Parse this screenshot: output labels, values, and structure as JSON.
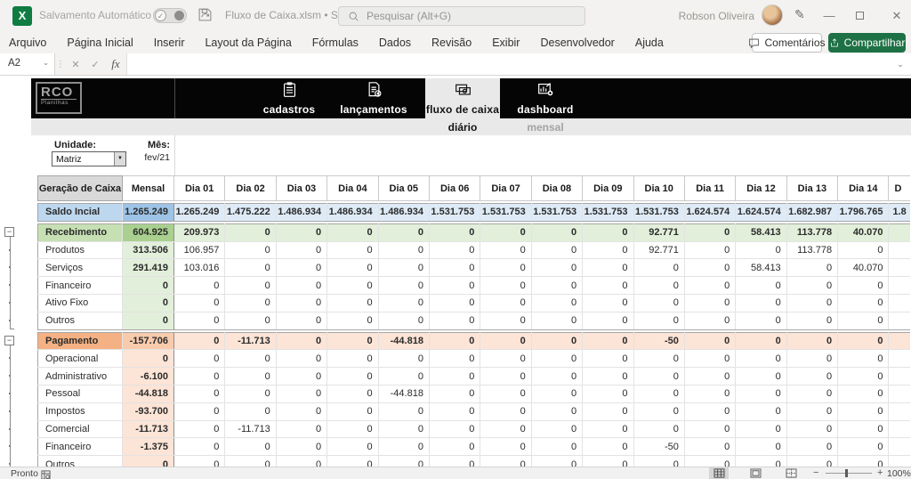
{
  "colors": {
    "excel_brand_green": "#107c41",
    "share_button_green": "#1e7145",
    "header_band_black": "#050505",
    "active_tab_gray": "#e9e9e9",
    "saldo_row_blue": "#9dc3e6",
    "saldo_row_light_blue": "#deebf7",
    "inflow_green": "#a9d08e",
    "inflow_light_green": "#e2efda",
    "outflow_orange": "#f4b183",
    "outflow_light_orange": "#fce4d6"
  },
  "title_bar": {
    "autosave_label": "Salvamento Automático",
    "document_title": "Fluxo de Caixa.xlsm • Salvo",
    "search_placeholder": "Pesquisar (Alt+G)",
    "user_name": "Robson Oliveira"
  },
  "menu_bar": {
    "items": [
      "Arquivo",
      "Página Inicial",
      "Inserir",
      "Layout da Página",
      "Fórmulas",
      "Dados",
      "Revisão",
      "Exibir",
      "Desenvolvedor",
      "Ajuda"
    ],
    "comments_button": "Comentários",
    "share_button": "Compartilhar"
  },
  "formula_bar": {
    "cell_reference": "A2",
    "fx_label": "fx",
    "formula_value": ""
  },
  "workbook_header": {
    "logo_title": "RCO",
    "logo_subtitle": "Planilhas",
    "tabs": [
      {
        "label": "cadastros",
        "icon": "clipboard-icon",
        "active": false
      },
      {
        "label": "lançamentos",
        "icon": "journal-icon",
        "active": false
      },
      {
        "label": "fluxo de caixa",
        "icon": "cash-icon",
        "active": true
      },
      {
        "label": "dashboard",
        "icon": "chart-icon",
        "active": false
      }
    ],
    "view_tabs": [
      {
        "label": "diário",
        "active": true
      },
      {
        "label": "mensal",
        "active": false
      }
    ]
  },
  "filters": {
    "unit_label": "Unidade:",
    "unit_value": "Matriz",
    "month_label": "Mês:",
    "month_value": "fev/21"
  },
  "table": {
    "corner_header": "Geração de Caixa",
    "monthly_header": "Mensal",
    "day_headers": [
      "Dia 01",
      "Dia 02",
      "Dia 03",
      "Dia 04",
      "Dia 05",
      "Dia 06",
      "Dia 07",
      "Dia 08",
      "Dia 09",
      "Dia 10",
      "Dia 11",
      "Dia 12",
      "Dia 13",
      "Dia 14"
    ],
    "clipped_day_header": "D",
    "rows": [
      {
        "label": "Saldo Incial",
        "kind": "saldo",
        "mensal": "1.265.249",
        "days": [
          "1.265.249",
          "1.475.222",
          "1.486.934",
          "1.486.934",
          "1.486.934",
          "1.531.753",
          "1.531.753",
          "1.531.753",
          "1.531.753",
          "1.531.753",
          "1.624.574",
          "1.624.574",
          "1.682.987",
          "1.796.765"
        ],
        "clipped": "1.8"
      },
      {
        "label": "Recebimento",
        "kind": "group-in",
        "mensal": "604.925",
        "days": [
          "209.973",
          "0",
          "0",
          "0",
          "0",
          "0",
          "0",
          "0",
          "0",
          "92.771",
          "0",
          "58.413",
          "113.778",
          "40.070"
        ],
        "clipped": ""
      },
      {
        "label": "Produtos",
        "kind": "child-in",
        "mensal": "313.506",
        "days": [
          "106.957",
          "0",
          "0",
          "0",
          "0",
          "0",
          "0",
          "0",
          "0",
          "92.771",
          "0",
          "0",
          "113.778",
          "0"
        ],
        "clipped": ""
      },
      {
        "label": "Serviços",
        "kind": "child-in",
        "mensal": "291.419",
        "days": [
          "103.016",
          "0",
          "0",
          "0",
          "0",
          "0",
          "0",
          "0",
          "0",
          "0",
          "0",
          "58.413",
          "0",
          "40.070"
        ],
        "clipped": ""
      },
      {
        "label": "Financeiro",
        "kind": "child-in",
        "mensal": "0",
        "days": [
          "0",
          "0",
          "0",
          "0",
          "0",
          "0",
          "0",
          "0",
          "0",
          "0",
          "0",
          "0",
          "0",
          "0"
        ],
        "clipped": ""
      },
      {
        "label": "Ativo Fixo",
        "kind": "child-in",
        "mensal": "0",
        "days": [
          "0",
          "0",
          "0",
          "0",
          "0",
          "0",
          "0",
          "0",
          "0",
          "0",
          "0",
          "0",
          "0",
          "0"
        ],
        "clipped": ""
      },
      {
        "label": "Outros",
        "kind": "child-in",
        "mensal": "0",
        "days": [
          "0",
          "0",
          "0",
          "0",
          "0",
          "0",
          "0",
          "0",
          "0",
          "0",
          "0",
          "0",
          "0",
          "0"
        ],
        "clipped": ""
      },
      {
        "label": "Pagamento",
        "kind": "group-out",
        "mensal": "-157.706",
        "days": [
          "0",
          "-11.713",
          "0",
          "0",
          "-44.818",
          "0",
          "0",
          "0",
          "0",
          "-50",
          "0",
          "0",
          "0",
          "0"
        ],
        "clipped": ""
      },
      {
        "label": "Operacional",
        "kind": "child-out",
        "mensal": "0",
        "days": [
          "0",
          "0",
          "0",
          "0",
          "0",
          "0",
          "0",
          "0",
          "0",
          "0",
          "0",
          "0",
          "0",
          "0"
        ],
        "clipped": ""
      },
      {
        "label": "Administrativo",
        "kind": "child-out",
        "mensal": "-6.100",
        "days": [
          "0",
          "0",
          "0",
          "0",
          "0",
          "0",
          "0",
          "0",
          "0",
          "0",
          "0",
          "0",
          "0",
          "0"
        ],
        "clipped": ""
      },
      {
        "label": "Pessoal",
        "kind": "child-out",
        "mensal": "-44.818",
        "days": [
          "0",
          "0",
          "0",
          "0",
          "-44.818",
          "0",
          "0",
          "0",
          "0",
          "0",
          "0",
          "0",
          "0",
          "0"
        ],
        "clipped": ""
      },
      {
        "label": "Impostos",
        "kind": "child-out",
        "mensal": "-93.700",
        "days": [
          "0",
          "0",
          "0",
          "0",
          "0",
          "0",
          "0",
          "0",
          "0",
          "0",
          "0",
          "0",
          "0",
          "0"
        ],
        "clipped": ""
      },
      {
        "label": "Comercial",
        "kind": "child-out",
        "mensal": "-11.713",
        "days": [
          "0",
          "-11.713",
          "0",
          "0",
          "0",
          "0",
          "0",
          "0",
          "0",
          "0",
          "0",
          "0",
          "0",
          "0"
        ],
        "clipped": ""
      },
      {
        "label": "Financeiro",
        "kind": "child-out",
        "mensal": "-1.375",
        "days": [
          "0",
          "0",
          "0",
          "0",
          "0",
          "0",
          "0",
          "0",
          "0",
          "-50",
          "0",
          "0",
          "0",
          "0"
        ],
        "clipped": ""
      },
      {
        "label": "Outros",
        "kind": "child-out",
        "mensal": "0",
        "days": [
          "0",
          "0",
          "0",
          "0",
          "0",
          "0",
          "0",
          "0",
          "0",
          "0",
          "0",
          "0",
          "0",
          "0"
        ],
        "clipped": ""
      }
    ]
  },
  "status_bar": {
    "ready_label": "Pronto",
    "zoom_percent": "100%"
  }
}
